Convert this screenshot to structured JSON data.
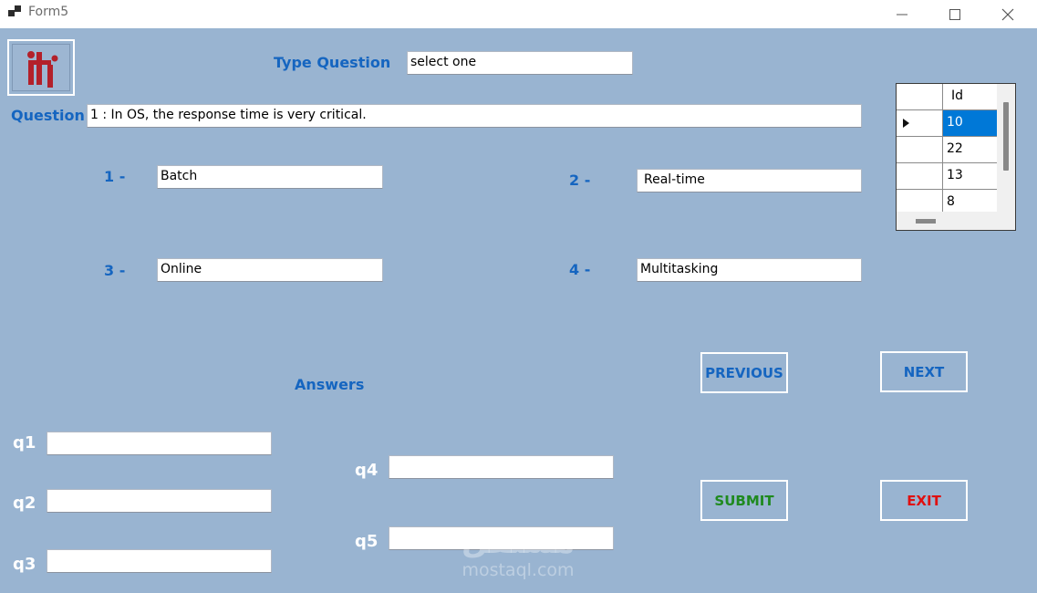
{
  "window": {
    "title": "Form5"
  },
  "logo": {
    "icon": "iti-logo"
  },
  "question_type": {
    "label": "Type Question",
    "value": "select one"
  },
  "question": {
    "label": "Question",
    "text": "1 : In OS, the response time is very critical."
  },
  "options": [
    {
      "label": "1 -",
      "value": "Batch"
    },
    {
      "label": "2 -",
      "value": "Real-time"
    },
    {
      "label": "3 -",
      "value": "Online"
    },
    {
      "label": "4 -",
      "value": "Multitasking"
    }
  ],
  "answers": {
    "heading": "Answers",
    "fields": [
      {
        "label": "q1",
        "value": ""
      },
      {
        "label": "q2",
        "value": ""
      },
      {
        "label": "q3",
        "value": ""
      },
      {
        "label": "q4",
        "value": ""
      },
      {
        "label": "q5",
        "value": ""
      }
    ]
  },
  "buttons": {
    "previous": "PREVIOUS",
    "next": "NEXT",
    "submit": "SUBMIT",
    "exit": "EXIT"
  },
  "grid": {
    "column": "Id",
    "rows": [
      "10",
      "22",
      "13",
      "8"
    ],
    "selected_index": 0
  },
  "watermark": {
    "arabic": "مستقل",
    "latin": "mostaql.com"
  },
  "colors": {
    "label_blue": "#1565c0",
    "submit_green": "#1f8a1f",
    "exit_red": "#e01010",
    "form_bg": "#99b4d1",
    "selection": "#0078d7"
  }
}
